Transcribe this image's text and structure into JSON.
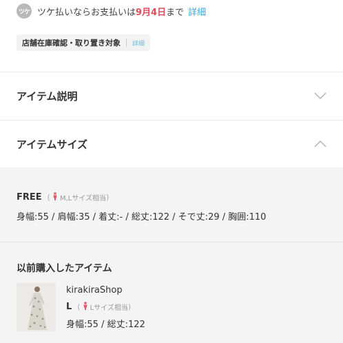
{
  "tsuke": {
    "badge": "ツケ",
    "text_before": "ツケ払いならお支払いは",
    "date": "9月4日",
    "text_after": "まで",
    "detail_link": "詳細"
  },
  "store_stock": {
    "label": "店舗在庫確認・取り置き対象",
    "detail_link": "詳細"
  },
  "sections": {
    "description_title": "アイテム説明",
    "size_title": "アイテムサイズ"
  },
  "size": {
    "name": "FREE",
    "equivalent": "M,Lサイズ相当",
    "measurements": "身幅:55 / 肩幅:35 / 着丈:- / 総丈:122 / そで丈:29 / 胸囲:110"
  },
  "purchased": {
    "title": "以前購入したアイテム",
    "shop": "kirakiraShop",
    "size_name": "L",
    "equivalent": "Lサイズ相当",
    "measurements": "身幅:55 / 総丈:122"
  },
  "colors": {
    "highlight": "#e24b5a",
    "link": "#3ba8d6",
    "person_icon": "#e05a6a"
  }
}
